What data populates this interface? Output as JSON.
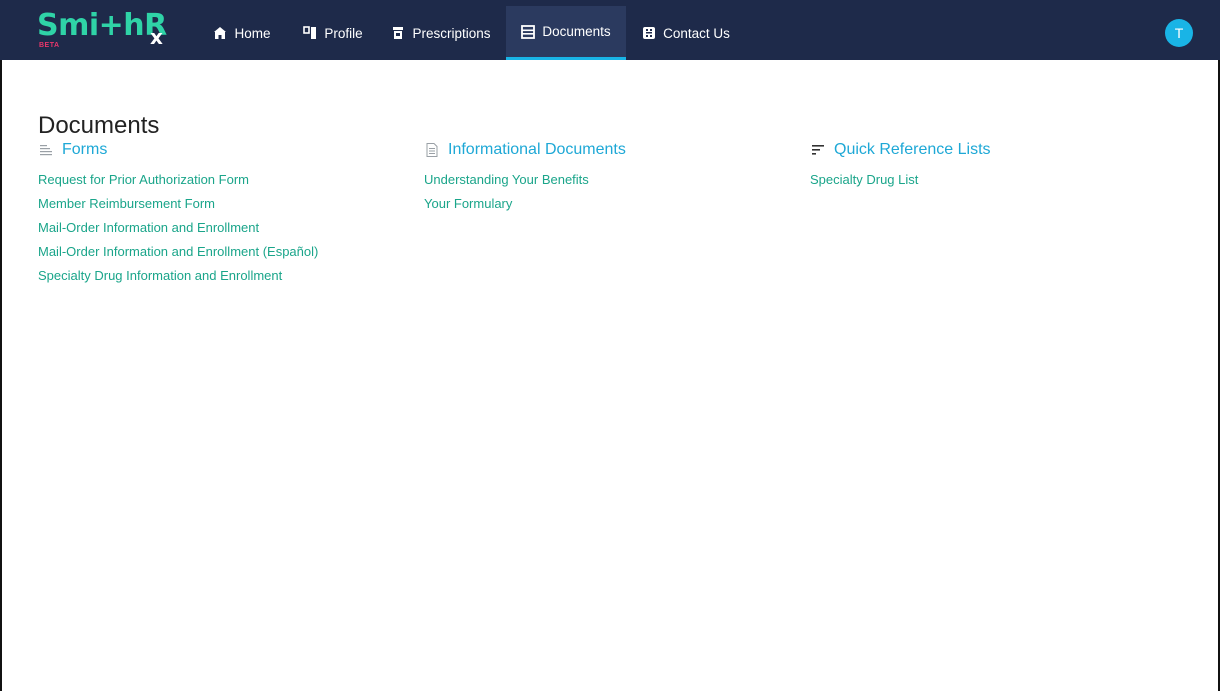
{
  "brand": {
    "logo_text": "Smi+hR",
    "logo_x": "x",
    "beta_label": "BETA"
  },
  "nav": {
    "items": [
      {
        "label": "Home",
        "icon": "home-icon"
      },
      {
        "label": "Profile",
        "icon": "id-card-icon"
      },
      {
        "label": "Prescriptions",
        "icon": "pill-bottle-icon"
      },
      {
        "label": "Documents",
        "icon": "documents-icon",
        "active": true
      },
      {
        "label": "Contact Us",
        "icon": "contact-icon"
      }
    ],
    "avatar_initial": "T"
  },
  "page": {
    "title": "Documents"
  },
  "sections": {
    "forms": {
      "title": "Forms",
      "icon": "list-lines-icon",
      "links": [
        "Request for Prior Authorization Form",
        "Member Reimbursement Form",
        "Mail-Order Information and Enrollment",
        "Mail-Order Information and Enrollment (Español)",
        "Specialty Drug Information and Enrollment"
      ]
    },
    "info": {
      "title": "Informational Documents",
      "icon": "document-icon",
      "links": [
        "Understanding Your Benefits",
        "Your Formulary"
      ]
    },
    "quick": {
      "title": "Quick Reference Lists",
      "icon": "sort-lines-icon",
      "links": [
        "Specialty Drug List"
      ]
    }
  },
  "colors": {
    "navbar": "#1e2a4a",
    "accent_blue": "#1ea8d6",
    "link_green": "#1aa58a",
    "brand_green": "#2fd3a7"
  }
}
